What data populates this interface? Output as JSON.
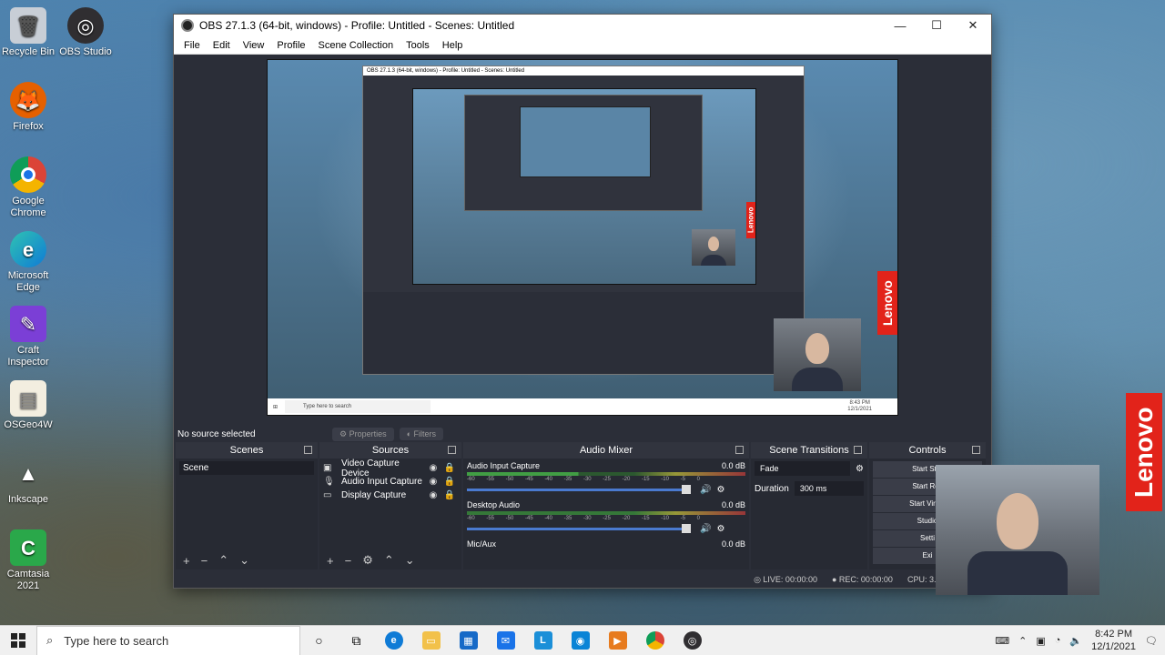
{
  "desktop": {
    "icons": [
      {
        "label": "Recycle Bin",
        "color": "#c8ced6"
      },
      {
        "label": "OBS Studio",
        "color": "#302e31"
      },
      {
        "label": "Firefox",
        "color": "#e66000"
      },
      {
        "label": "Google Chrome",
        "color": "#1a73e8"
      },
      {
        "label": "Microsoft Edge",
        "color": "#0f7bd6"
      },
      {
        "label": "Craft Inspector",
        "color": "#7b3fd6"
      },
      {
        "label": "OSGeo4W",
        "color": "#f3eee0"
      },
      {
        "label": "Inkscape",
        "color": "#2a2a2a"
      },
      {
        "label": "Camtasia 2021",
        "color": "#2aa84a"
      }
    ],
    "lenovo": "Lenovo"
  },
  "obs": {
    "title": "OBS 27.1.3 (64-bit, windows) - Profile: Untitled - Scenes: Untitled",
    "menu": [
      "File",
      "Edit",
      "View",
      "Profile",
      "Scene Collection",
      "Tools",
      "Help"
    ],
    "source_bar": {
      "selected": "No source selected",
      "properties": "Properties",
      "filters": "Filters"
    },
    "docks": {
      "scenes": {
        "title": "Scenes",
        "items": [
          "Scene"
        ]
      },
      "sources": {
        "title": "Sources",
        "items": [
          "Video Capture Device",
          "Audio Input Capture",
          "Display Capture"
        ]
      },
      "mixer": {
        "title": "Audio Mixer",
        "channels": [
          {
            "name": "Audio Input Capture",
            "db": "0.0 dB"
          },
          {
            "name": "Desktop Audio",
            "db": "0.0 dB"
          },
          {
            "name": "Mic/Aux",
            "db": "0.0 dB"
          }
        ],
        "scale": [
          "-60",
          "-55",
          "-50",
          "-45",
          "-40",
          "-35",
          "-30",
          "-25",
          "-20",
          "-15",
          "-10",
          "-5",
          "0"
        ]
      },
      "transitions": {
        "title": "Scene Transitions",
        "type": "Fade",
        "duration_label": "Duration",
        "duration_value": "300 ms"
      },
      "controls": {
        "title": "Controls",
        "buttons": [
          "Start Stre",
          "Start Rec",
          "Start Virtua",
          "Studio",
          "Setti",
          "Exi"
        ]
      }
    },
    "status": {
      "live": "LIVE: 00:00:00",
      "rec": "REC: 00:00:00",
      "cpu": "CPU: 3.0%, 30.00 fp"
    },
    "preview": {
      "nested_title": "OBS 27.1.3 (64-bit, windows) - Profile: Untitled - Scenes: Untitled",
      "taskbar_search": "Type here to search",
      "time": "8:43 PM",
      "date": "12/1/2021"
    }
  },
  "taskbar": {
    "search_placeholder": "Type here to search",
    "time": "8:42 PM",
    "date": "12/1/2021"
  }
}
